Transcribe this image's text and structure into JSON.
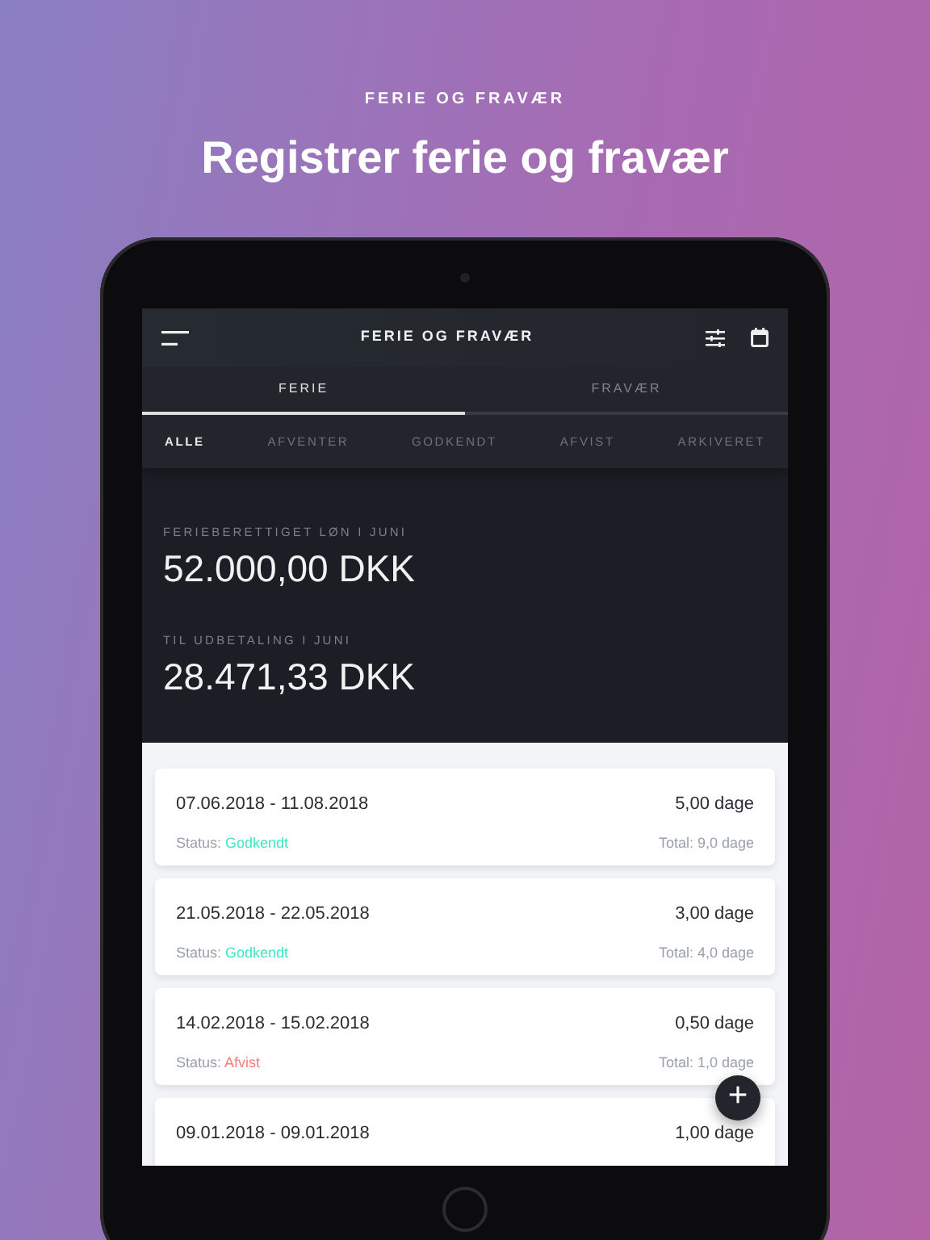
{
  "eyebrow": "FERIE OG FRAVÆR",
  "headline": "Registrer ferie og fravær",
  "app": {
    "title": "FERIE OG FRAVÆR",
    "tabs": [
      {
        "label": "FERIE",
        "selected": true
      },
      {
        "label": "FRAVÆR",
        "selected": false
      }
    ],
    "filters": [
      {
        "label": "ALLE",
        "selected": true
      },
      {
        "label": "AFVENTER",
        "selected": false
      },
      {
        "label": "GODKENDT",
        "selected": false
      },
      {
        "label": "AFVIST",
        "selected": false
      },
      {
        "label": "ARKIVERET",
        "selected": false
      }
    ],
    "summary": [
      {
        "label": "FERIEBERETTIGET LØN I JUNI",
        "amount": "52.000,00 DKK"
      },
      {
        "label": "TIL UDBETALING I JUNI",
        "amount": "28.471,33 DKK"
      }
    ],
    "entries": [
      {
        "period": "07.06.2018 - 11.08.2018",
        "days": "5,00 dage",
        "status_label": "Status:",
        "status": "Godkendt",
        "color": "#3ee6c4",
        "total": "Total: 9,0 dage"
      },
      {
        "period": "21.05.2018 - 22.05.2018",
        "days": "3,00 dage",
        "status_label": "Status:",
        "status": "Godkendt",
        "color": "#3ee6c4",
        "total": "Total: 4,0 dage"
      },
      {
        "period": "14.02.2018 - 15.02.2018",
        "days": "0,50 dage",
        "status_label": "Status:",
        "status": "Afvist",
        "color": "#ff7a7a",
        "total": "Total: 1,0 dage"
      },
      {
        "period": "09.01.2018 - 09.01.2018",
        "days": "1,00 dage"
      }
    ],
    "fab": "+"
  }
}
